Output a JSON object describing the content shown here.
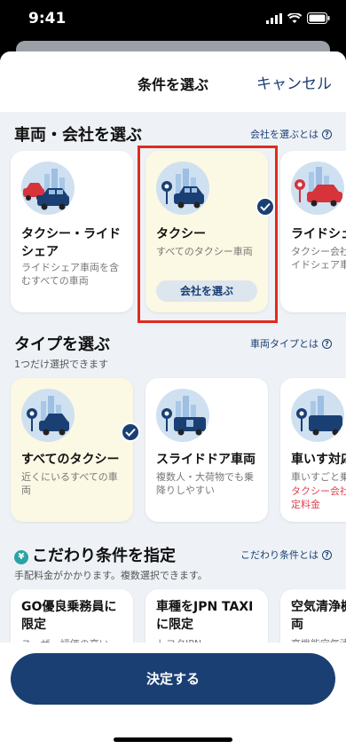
{
  "status": {
    "time": "9:41"
  },
  "header": {
    "title": "条件を選ぶ",
    "cancel": "キャンセル"
  },
  "vehicle_section": {
    "title": "車両・会社を選ぶ",
    "link": "会社を選ぶとは",
    "cards": [
      {
        "title": "タクシー・ライドシェア",
        "desc": "ライドシェア車両を含むすべての車両"
      },
      {
        "title": "タクシー",
        "desc": "すべてのタクシー車両",
        "button": "会社を選ぶ"
      },
      {
        "title": "ライドシェ",
        "desc": "タクシー会社によるライドシェア車両"
      }
    ]
  },
  "type_section": {
    "title": "タイプを選ぶ",
    "subtitle": "1つだけ選択できます",
    "link": "車両タイプとは",
    "cards": [
      {
        "title": "すべてのタクシー",
        "desc": "近くにいるすべての車両"
      },
      {
        "title": "スライドドア車両",
        "desc": "複数人・大荷物でも乗降りしやすい"
      },
      {
        "title": "車いす対応",
        "desc": "車いすごと乗車",
        "note": "タクシー会社・車両指定料金"
      }
    ]
  },
  "pref_section": {
    "icon": "¥",
    "title": "こだわり条件を指定",
    "subtitle": "手配料金がかかります。複数選択できます。",
    "link": "こだわり条件とは",
    "cards": [
      {
        "title": "GO優良乗務員に限定",
        "desc": "ユーザー評価の高い"
      },
      {
        "title": "車種をJPN TAXIに限定",
        "desc": "トヨタJPN"
      },
      {
        "title": "空気清浄機搭載車両",
        "desc": "高機能空気清"
      }
    ]
  },
  "footer": {
    "button": "決定する"
  },
  "colors": {
    "navy": "#1a3f73",
    "selected_bg": "#fbf8e3",
    "highlight": "#e02b1d"
  }
}
